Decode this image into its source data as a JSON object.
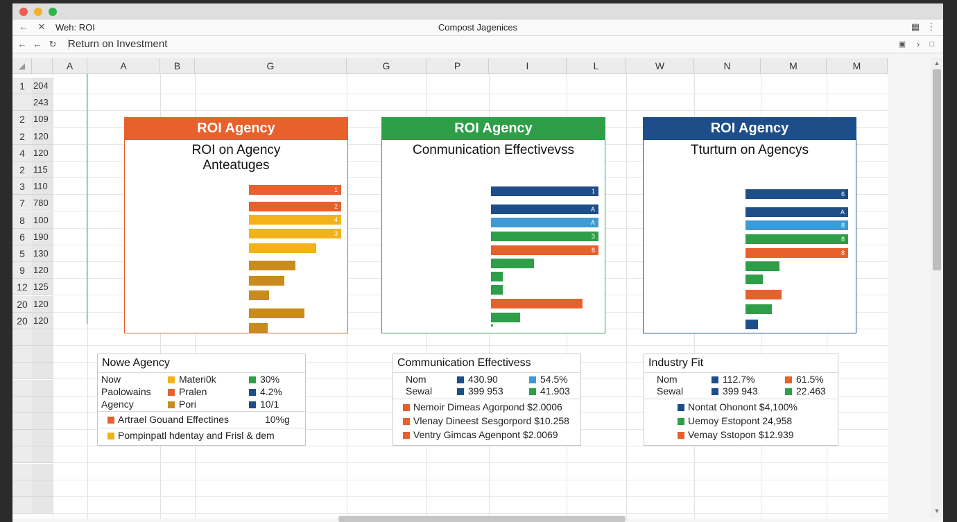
{
  "window": {
    "tab_title": "Weh: ROI",
    "center_title": "Compost Jagenices"
  },
  "address": {
    "value": "Return on Investment"
  },
  "columns": [
    "A",
    "A",
    "B",
    "G",
    "G",
    "P",
    "I",
    "L",
    "W",
    "N",
    "M",
    "M"
  ],
  "rows": [
    {
      "num": "1",
      "val": "204"
    },
    {
      "num": "",
      "val": "243"
    },
    {
      "num": "2",
      "val": "109"
    },
    {
      "num": "2",
      "val": "120"
    },
    {
      "num": "4",
      "val": "120"
    },
    {
      "num": "2",
      "val": "115"
    },
    {
      "num": "3",
      "val": "110"
    },
    {
      "num": "7",
      "val": "780"
    },
    {
      "num": "8",
      "val": "100"
    },
    {
      "num": "6",
      "val": "190"
    },
    {
      "num": "5",
      "val": "130"
    },
    {
      "num": "9",
      "val": "120"
    },
    {
      "num": "12",
      "val": "125"
    },
    {
      "num": "20",
      "val": "120"
    },
    {
      "num": "20",
      "val": "120"
    }
  ],
  "colors": {
    "orange": "#e8602c",
    "green": "#2e9e48",
    "blue": "#1d4e89",
    "yellow": "#f4b21a",
    "gold": "#c98a1e",
    "lightblue": "#3e9ad6"
  },
  "panels": [
    {
      "header": "ROI Agency",
      "sub1": "ROI on Agency",
      "sub2": "Anteatuges",
      "color": "#e8602c",
      "bars": [
        {
          "value": 1.0,
          "color": "#e8602c",
          "label": "1"
        },
        {
          "value": 1.0,
          "color": "#e8602c",
          "label": "2"
        },
        {
          "value": 1.0,
          "color": "#f4b21a",
          "label": "4"
        },
        {
          "value": 1.0,
          "color": "#f4b21a",
          "label": "3"
        },
        {
          "value": 0.73,
          "color": "#f4b21a",
          "label": ""
        },
        {
          "value": 0.5,
          "color": "#c98a1e",
          "label": ""
        },
        {
          "value": 0.38,
          "color": "#c98a1e",
          "label": ""
        },
        {
          "value": 0.22,
          "color": "#c98a1e",
          "label": ""
        },
        {
          "value": 0.6,
          "color": "#c98a1e",
          "label": ""
        },
        {
          "value": 0.2,
          "color": "#c98a1e",
          "label": ""
        }
      ]
    },
    {
      "header": "ROI Agency",
      "sub1": "Conmunication Effectivevss",
      "sub2": "",
      "color": "#2e9e48",
      "bars": [
        {
          "value": 1.0,
          "color": "#1d4e89",
          "label": "1"
        },
        {
          "value": 1.0,
          "color": "#1d4e89",
          "label": "A"
        },
        {
          "value": 1.0,
          "color": "#3e9ad6",
          "label": "A"
        },
        {
          "value": 1.0,
          "color": "#2e9e48",
          "label": "3"
        },
        {
          "value": 1.0,
          "color": "#e8602c",
          "label": "8"
        },
        {
          "value": 0.4,
          "color": "#2e9e48",
          "label": ""
        },
        {
          "value": 0.11,
          "color": "#2e9e48",
          "label": ""
        },
        {
          "value": 0.11,
          "color": "#2e9e48",
          "label": ""
        },
        {
          "value": 0.85,
          "color": "#e8602c",
          "label": ""
        },
        {
          "value": 0.27,
          "color": "#2e9e48",
          "label": ""
        },
        {
          "value": 0.02,
          "color": "#2e9e48",
          "label": ""
        }
      ]
    },
    {
      "header": "ROI Agency",
      "sub1": "Tturturn on Agencys",
      "sub2": "",
      "color": "#1d4e89",
      "bars": [
        {
          "value": 1.0,
          "color": "#1d4e89",
          "label": "6"
        },
        {
          "value": 1.0,
          "color": "#1d4e89",
          "label": "A"
        },
        {
          "value": 1.0,
          "color": "#3e9ad6",
          "label": "8"
        },
        {
          "value": 1.0,
          "color": "#2e9e48",
          "label": "8"
        },
        {
          "value": 1.0,
          "color": "#e8602c",
          "label": "8"
        },
        {
          "value": 0.33,
          "color": "#2e9e48",
          "label": ""
        },
        {
          "value": 0.17,
          "color": "#2e9e48",
          "label": ""
        },
        {
          "value": 0.35,
          "color": "#e8602c",
          "label": ""
        },
        {
          "value": 0.26,
          "color": "#2e9e48",
          "label": ""
        },
        {
          "value": 0.12,
          "color": "#1d4e89",
          "label": ""
        },
        {
          "value": 0.01,
          "color": "#1d4e89",
          "label": ""
        }
      ]
    }
  ],
  "tables": [
    {
      "title": "Nowe Agency",
      "rows": [
        {
          "label": "Now",
          "c1": "Materi0k",
          "k1": "#f4b21a",
          "c2": "30%",
          "k2": "#2e9e48"
        },
        {
          "label": "Paolowains",
          "c1": "Pralen",
          "k1": "#e8602c",
          "c2": "4.2%",
          "k2": "#1d4e89"
        },
        {
          "label": "Agency",
          "c1": "Pori",
          "k1": "#c98a1e",
          "c2": "10/1",
          "k2": "#1d4e89"
        }
      ],
      "extra": [
        {
          "text": "Artrael Gouand Effectines",
          "value": "10%g",
          "k": "#e8602c"
        },
        {
          "text": "Pompinpatl hdentay and Frisl & dem",
          "value": "",
          "k": "#f4b21a"
        }
      ]
    },
    {
      "title": "Communication Effectivess",
      "rows": [
        {
          "label": "Nom",
          "c1": "430.90",
          "k1": "#1d4e89",
          "c2": "54.5%",
          "k2": "#3e9ad6"
        },
        {
          "label": "Sewal",
          "c1": "399 953",
          "k1": "#1d4e89",
          "c2": "41.903",
          "k2": "#2e9e48"
        }
      ],
      "extra": [
        {
          "text": "Nemoir Dimeas Agorpond $2.0006",
          "value": "",
          "k": "#e8602c"
        },
        {
          "text": "Vlenay Dineest Sesgorpord $10.258",
          "value": "",
          "k": "#e8602c"
        },
        {
          "text": "Ventry Gimcas Agenpont $2.0069",
          "value": "",
          "k": "#e8602c"
        }
      ]
    },
    {
      "title": "Industry Fit",
      "rows": [
        {
          "label": "Nom",
          "c1": "112.7%",
          "k1": "#1d4e89",
          "c2": "61.5%",
          "k2": "#e8602c"
        },
        {
          "label": "Sewal",
          "c1": "399 943",
          "k1": "#1d4e89",
          "c2": "22.463",
          "k2": "#2e9e48"
        }
      ],
      "extra": [
        {
          "text": "Nontat Ohonont $4,100%",
          "value": "",
          "k": "#1d4e89"
        },
        {
          "text": "Uemoy Estopont 24,958",
          "value": "",
          "k": "#2e9e48"
        },
        {
          "text": "Vemay Sstopon $12.939",
          "value": "",
          "k": "#e8602c"
        }
      ]
    }
  ]
}
